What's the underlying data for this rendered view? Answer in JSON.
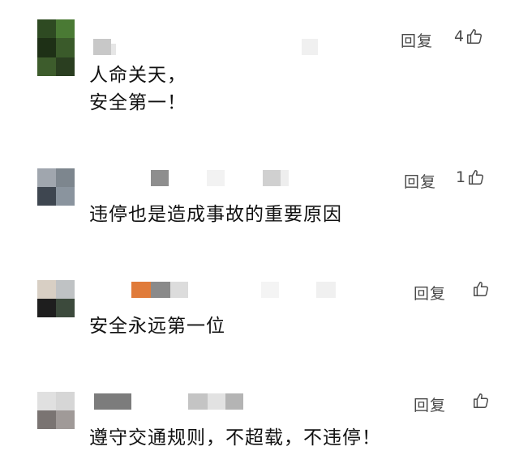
{
  "comments": [
    {
      "reply_label": "回复",
      "like_count": "4",
      "text": "人命关天，\n安全第一！",
      "avatar_colors": [
        "#2e4a22",
        "#4a7a34",
        "#1e3016",
        "#3a5a2a"
      ]
    },
    {
      "reply_label": "回复",
      "like_count": "1",
      "text": "违停也是造成事故的重要原因",
      "avatar_colors": [
        "#a0a6ae",
        "#7d868e",
        "#3e4650",
        "#8a949e"
      ]
    },
    {
      "reply_label": "回复",
      "like_count": "",
      "text": "安全永远第一位",
      "avatar_colors": [
        "#d8cfc4",
        "#bfc2c4",
        "#1e1e1e",
        "#3c4a3c"
      ]
    },
    {
      "reply_label": "回复",
      "like_count": "",
      "text": "遵守交通规则，不超载，不违停！",
      "avatar_colors": [
        "#e0e0e0",
        "#d6d6d6",
        "#7a7472",
        "#a09a98"
      ]
    }
  ]
}
